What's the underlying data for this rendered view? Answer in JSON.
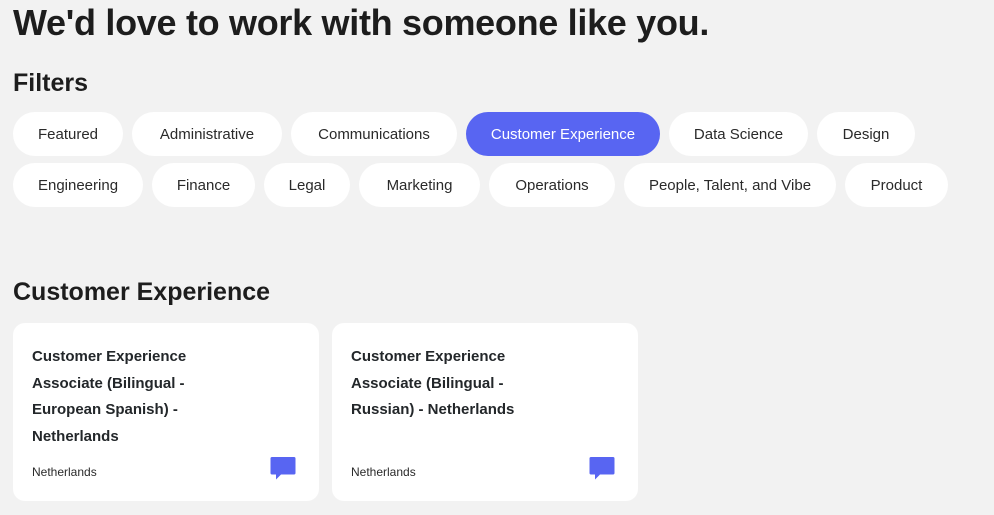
{
  "hero": {
    "title": "We'd love to work with someone like you."
  },
  "filters": {
    "title": "Filters",
    "selected": "Customer Experience",
    "items": [
      "Featured",
      "Administrative",
      "Communications",
      "Customer Experience",
      "Data Science",
      "Design",
      "Engineering",
      "Finance",
      "Legal",
      "Marketing",
      "Operations",
      "People, Talent, and Vibe",
      "Product"
    ]
  },
  "section": {
    "title": "Customer Experience"
  },
  "jobs": [
    {
      "title": "Customer Experience Associate (Bilingual - European Spanish) - Netherlands",
      "location": "Netherlands",
      "icon": "chat-bubble-icon"
    },
    {
      "title": "Customer Experience Associate (Bilingual - Russian) - Netherlands",
      "location": "Netherlands",
      "icon": "chat-bubble-icon"
    }
  ],
  "colors": {
    "accent": "#5865f2",
    "background": "#f2f2f2",
    "card": "#ffffff"
  }
}
